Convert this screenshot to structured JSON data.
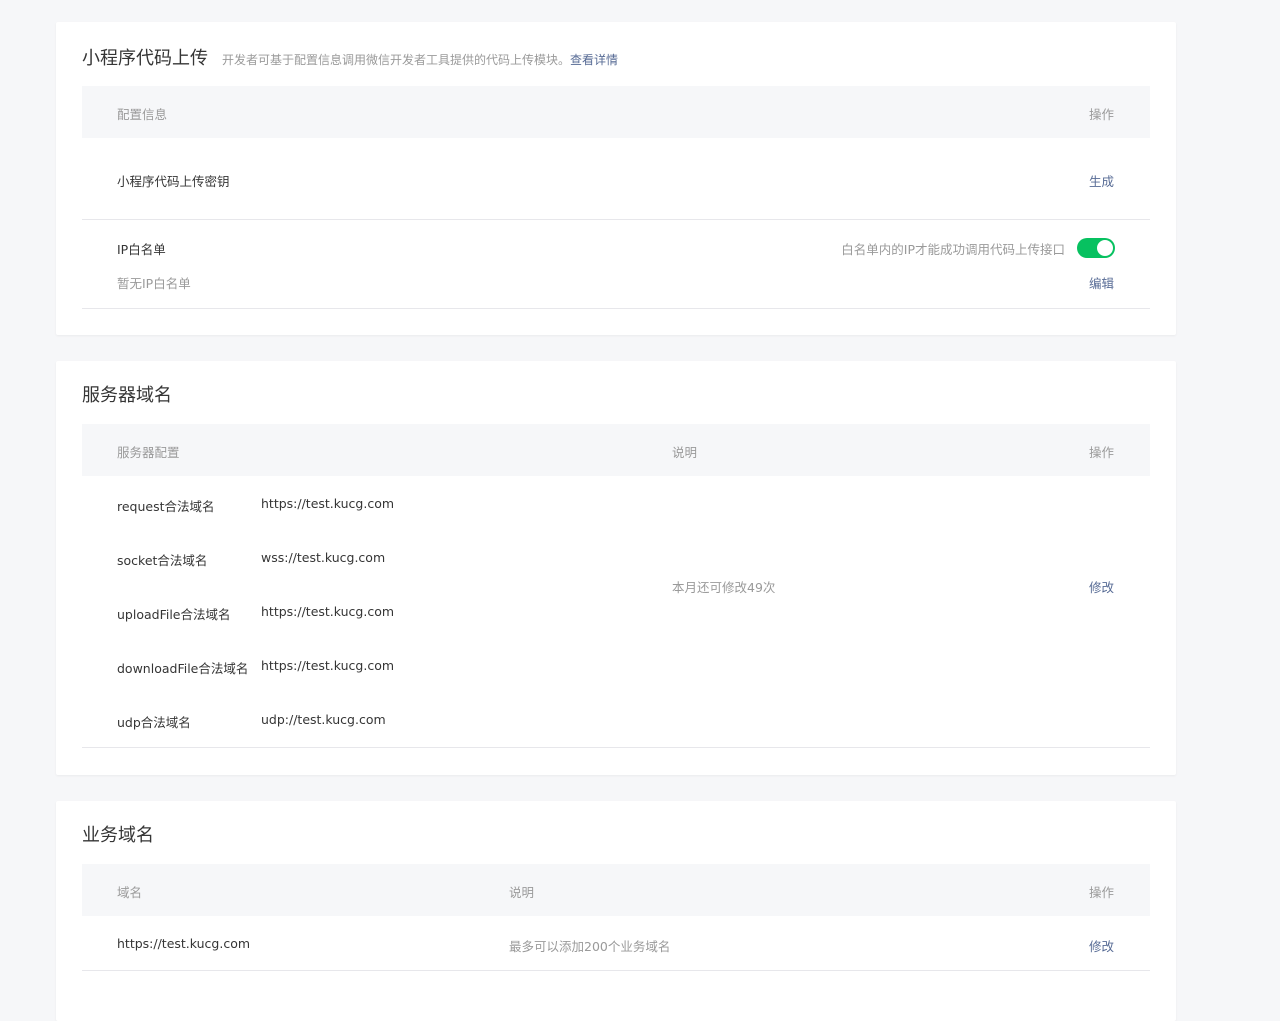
{
  "upload": {
    "title": "小程序代码上传",
    "desc": "开发者可基于配置信息调用微信开发者工具提供的代码上传模块。",
    "desc_link": "查看详情",
    "col_config": "配置信息",
    "col_op": "操作",
    "key_label": "小程序代码上传密钥",
    "key_action": "生成",
    "ip_label": "IP白名单",
    "ip_empty": "暂无IP白名单",
    "ip_hint": "白名单内的IP才能成功调用代码上传接口",
    "ip_toggle_on": true,
    "ip_action": "编辑"
  },
  "server": {
    "title": "服务器域名",
    "col_config": "服务器配置",
    "col_desc": "说明",
    "col_op": "操作",
    "rows": [
      {
        "label": "request合法域名",
        "value": "https://test.kucg.com"
      },
      {
        "label": "socket合法域名",
        "value": "wss://test.kucg.com"
      },
      {
        "label": "uploadFile合法域名",
        "value": "https://test.kucg.com"
      },
      {
        "label": "downloadFile合法域名",
        "value": "https://test.kucg.com"
      },
      {
        "label": "udp合法域名",
        "value": "udp://test.kucg.com"
      }
    ],
    "note": "本月还可修改49次",
    "action": "修改"
  },
  "business": {
    "title": "业务域名",
    "col_domain": "域名",
    "col_desc": "说明",
    "col_op": "操作",
    "domain": "https://test.kucg.com",
    "note": "最多可以添加200个业务域名",
    "action": "修改"
  }
}
